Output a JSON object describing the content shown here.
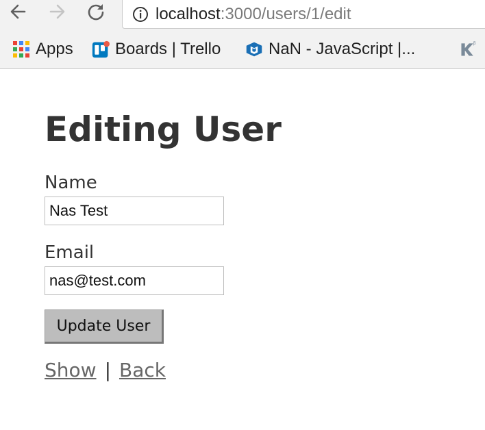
{
  "browser": {
    "url_host": "localhost",
    "url_path": ":3000/users/1/edit",
    "bookmarks": [
      {
        "label": "Apps",
        "icon": "apps-grid-icon"
      },
      {
        "label": "Boards | Trello",
        "icon": "trello-icon"
      },
      {
        "label": "NaN - JavaScript |...",
        "icon": "nan-icon"
      },
      {
        "label": "",
        "icon": "k-icon"
      }
    ]
  },
  "page": {
    "title": "Editing User",
    "name_label": "Name",
    "name_value": "Nas Test",
    "email_label": "Email",
    "email_value": "nas@test.com",
    "submit_label": "Update User",
    "show_link": "Show",
    "separator": "|",
    "back_link": "Back"
  }
}
